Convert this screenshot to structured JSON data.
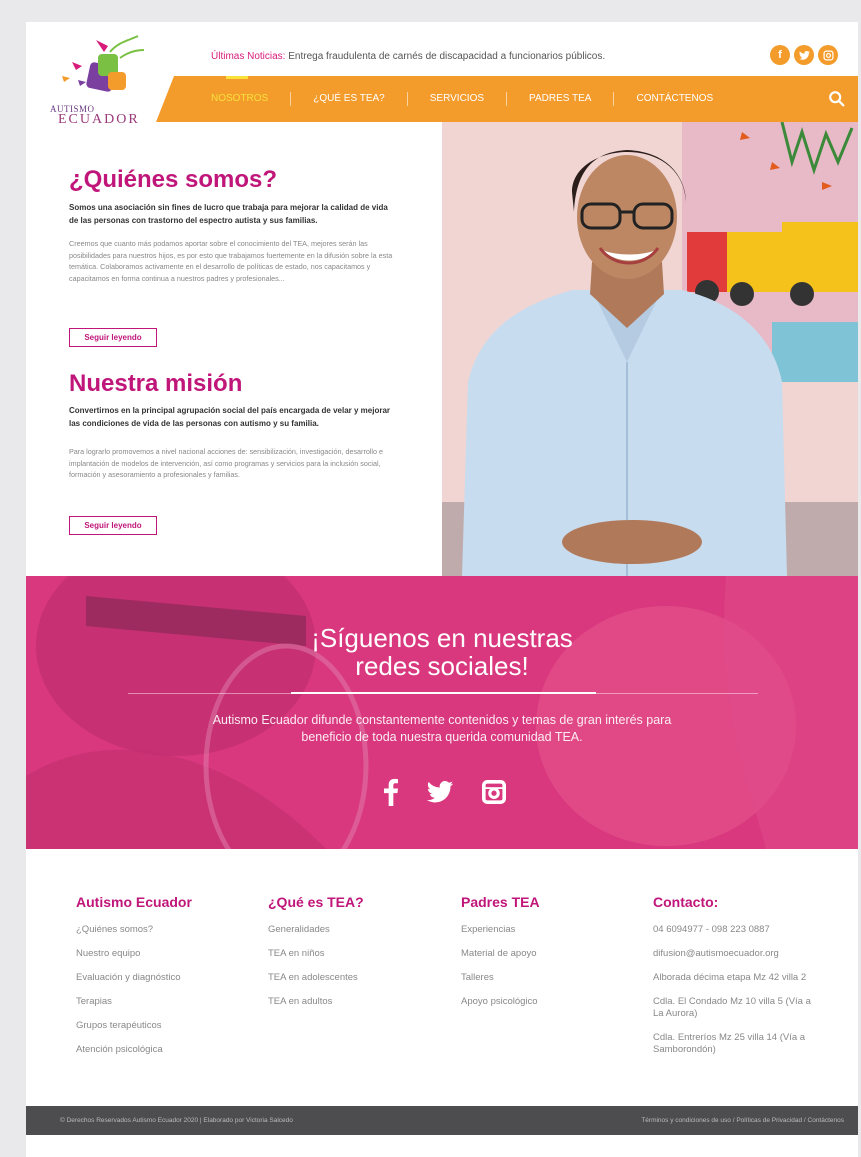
{
  "header": {
    "logo_line1": "AUTISMO",
    "logo_line2": "ECUADOR",
    "news_label": "Últimas Noticias:",
    "news_text": "Entrega fraudulenta de carnés de discapacidad a funcionarios públicos.",
    "social_icons": [
      "facebook-icon",
      "twitter-icon",
      "instagram-icon"
    ],
    "nav": [
      "NOSOTROS",
      "¿QUÉ ES TEA?",
      "SERVICIOS",
      "PADRES TEA",
      "CONTÁCTENOS"
    ]
  },
  "about": {
    "title": "¿Quiénes somos?",
    "lead": "Somos una asociación sin fines de lucro que trabaja para mejorar la calidad de vida de las personas con trastorno del espectro autista y sus familias.",
    "body": "Creemos que cuanto más podamos aportar sobre el conocimiento del TEA, mejores serán las posibilidades para nuestros hijos, es por esto que trabajamos fuertemente en la difusión sobre la esta temática. Colaboramos activamente en el desarrollo de políticas de estado, nos capacitamos y capacitamos en forma continua a nuestros padres y profesionales...",
    "button": "Seguir leyendo"
  },
  "mission": {
    "title": "Nuestra misión",
    "lead": "Convertirnos en la principal agrupación social del país encargada de velar y mejorar las condiciones de vida de las personas con autismo y su familia.",
    "body": "Para lograrlo promovemos a nivel nacional acciones de: sensibilización, investigación, desarrollo e implantación de modelos de intervención, así como programas y servicios para la inclusión social, formación y asesoramiento a profesionales y familias.",
    "button": "Seguir leyendo"
  },
  "social_band": {
    "title_line1": "¡Síguenos en nuestras",
    "title_line2": "redes sociales!",
    "text": "Autismo Ecuador difunde constantemente contenidos y temas de gran interés para beneficio de toda nuestra querida comunidad TEA.",
    "icons": [
      "facebook-icon",
      "twitter-icon",
      "instagram-icon"
    ]
  },
  "footer": {
    "col1": {
      "title": "Autismo Ecuador",
      "links": [
        "¿Quiénes somos?",
        "Nuestro equipo",
        "Evaluación y diagnóstico",
        "Terapias",
        "Grupos terapéuticos",
        "Atención psicológica"
      ]
    },
    "col2": {
      "title": "¿Qué es TEA?",
      "links": [
        "Generalidades",
        "TEA en niños",
        "TEA en adolescentes",
        "TEA en adultos"
      ]
    },
    "col3": {
      "title": "Padres TEA",
      "links": [
        "Experiencias",
        "Material de apoyo",
        "Talleres",
        "Apoyo psicológico"
      ]
    },
    "col4": {
      "title": "Contacto:",
      "items": [
        "04 6094977 - 098 223 0887",
        "difusion@autismoecuador.org",
        "Alborada décima etapa Mz 42 villa 2",
        "Cdla. El Condado Mz 10 villa 5 (Vía a La Aurora)",
        "Cdla. Entreríos Mz 25 villa 14 (Vía a Samborondón)"
      ]
    }
  },
  "bottom_bar": {
    "copyright": "© Derechos Reservados Autismo Ecuador 2020 | Elaborado por Victoria Salcedo",
    "links": "Términos y condiciones de uso  /  Políticas de Privacidad  /  Contáctenos"
  },
  "colors": {
    "magenta": "#c0167a",
    "orange": "#f39c2c",
    "band": "#d9387e"
  }
}
